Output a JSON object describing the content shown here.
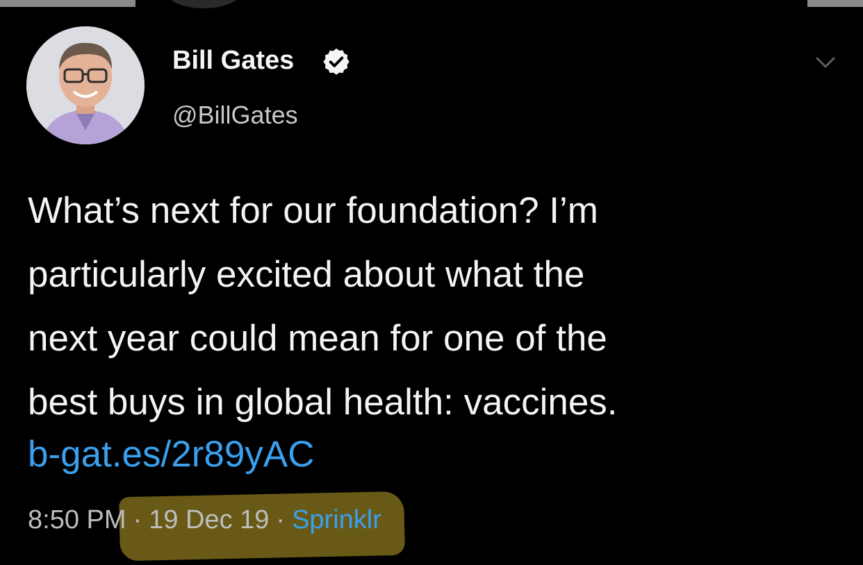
{
  "tweet": {
    "display_name": "Bill Gates",
    "handle": "@BillGates",
    "text_lines": [
      "What’s next for our foundation? I’m",
      "particularly excited about what the",
      "next year could mean for one of the",
      "best buys in global health: vaccines."
    ],
    "link": "b-gat.es/2r89yAC",
    "time": "8:50 PM",
    "separator": "·",
    "date": "19 Dec 19",
    "source": "Sprinklr"
  },
  "colors": {
    "background": "#000000",
    "link": "#3aa0ee",
    "verified_badge": "#f5f5f5",
    "highlight": "#7a6a1a"
  },
  "icons": {
    "verified": "verified-badge-icon",
    "caret": "chevron-down-icon"
  }
}
